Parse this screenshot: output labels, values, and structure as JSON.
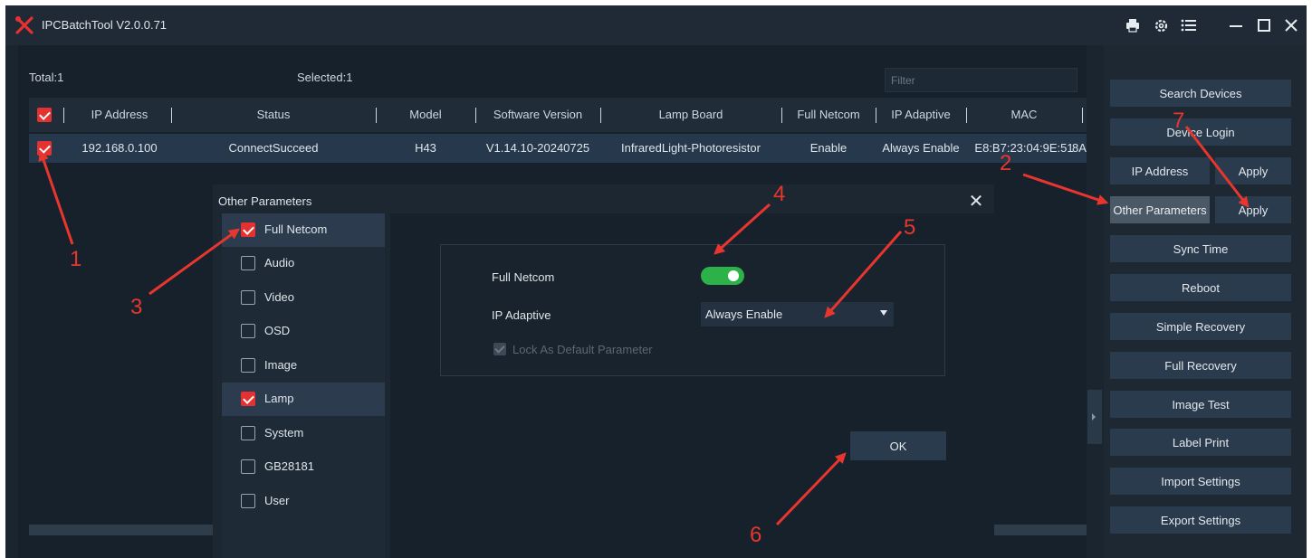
{
  "app": {
    "title": "IPCBatchTool V2.0.0.71",
    "icons": [
      "printer-icon",
      "settings-icon",
      "menu-list-icon",
      "minimize-icon",
      "maximize-icon",
      "close-icon"
    ]
  },
  "summary": {
    "total": "Total:1",
    "selected": "Selected:1",
    "filter_placeholder": "Filter"
  },
  "table": {
    "columns": [
      "IP Address",
      "Status",
      "Model",
      "Software Version",
      "Lamp Board",
      "Full Netcom",
      "IP Adaptive",
      "MAC"
    ],
    "rows": [
      {
        "ip": "192.168.0.100",
        "status": "ConnectSucceed",
        "model": "H43",
        "software": "V1.14.10-20240725",
        "lamp": "InfraredLight-Photoresistor",
        "full_netcom": "Enable",
        "ip_adaptive": "Always Enable",
        "mac": "E8:B7:23:04:9E:51",
        "overflow": "8A"
      }
    ]
  },
  "side": {
    "search": "Search Devices",
    "login": "Device Login",
    "ip_address": "IP Address",
    "ip_apply": "Apply",
    "other_params": "Other Parameters",
    "other_apply": "Apply",
    "sync_time": "Sync Time",
    "reboot": "Reboot",
    "simple_recovery": "Simple Recovery",
    "full_recovery": "Full Recovery",
    "image_test": "Image Test",
    "label_print": "Label Print",
    "import_settings": "Import Settings",
    "export_settings": "Export Settings"
  },
  "dialog": {
    "title": "Other Parameters",
    "nav": [
      {
        "label": "Full Netcom",
        "checked": true
      },
      {
        "label": "Audio",
        "checked": false
      },
      {
        "label": "Video",
        "checked": false
      },
      {
        "label": "OSD",
        "checked": false
      },
      {
        "label": "Image",
        "checked": false
      },
      {
        "label": "Lamp",
        "checked": true
      },
      {
        "label": "System",
        "checked": false
      },
      {
        "label": "GB28181",
        "checked": false
      },
      {
        "label": "User",
        "checked": false
      }
    ],
    "full_netcom_label": "Full Netcom",
    "full_netcom_on": true,
    "ip_adaptive_label": "IP Adaptive",
    "ip_adaptive_value": "Always Enable",
    "lock_label": "Lock As Default Parameter",
    "ok": "OK"
  },
  "annotations": {
    "n1": "1",
    "n2": "2",
    "n3": "3",
    "n4": "4",
    "n5": "5",
    "n6": "6",
    "n7": "7",
    "color": "#e8362f"
  },
  "colors": {
    "accent_red": "#e5312f",
    "toggle_green": "#2db24a",
    "panel_bg": "#1a2530"
  }
}
